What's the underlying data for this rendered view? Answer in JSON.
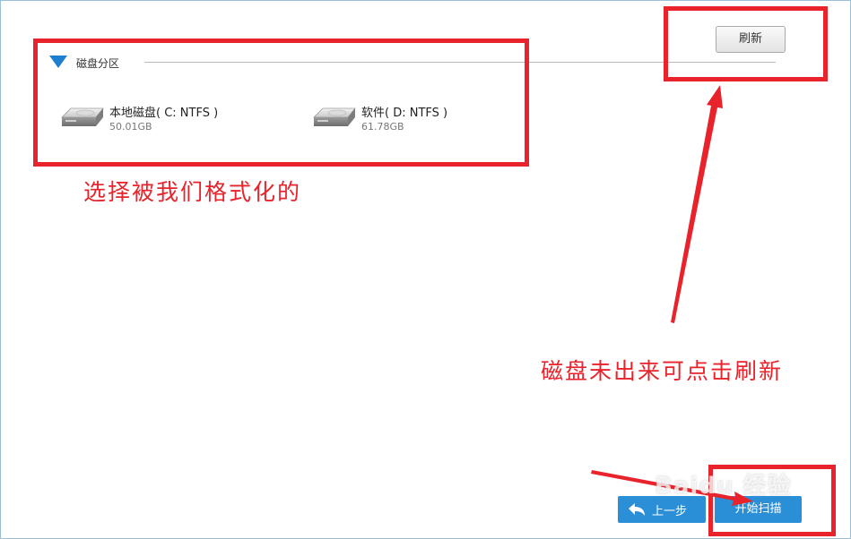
{
  "section": {
    "title": "磁盘分区"
  },
  "disks": [
    {
      "name": "本地磁盘( C: NTFS )",
      "size": "50.01GB",
      "icon": "hard-drive-icon"
    },
    {
      "name": "软件( D: NTFS )",
      "size": "61.78GB",
      "icon": "hard-drive-icon"
    }
  ],
  "toolbar": {
    "refresh_label": "刷新"
  },
  "footer": {
    "back_label": "上一步",
    "scan_label": "开始扫描"
  },
  "annotations": {
    "select_text": "选择被我们格式化的",
    "refresh_text": "磁盘未出来可点击刷新",
    "color": "#e8232b"
  },
  "watermark": {
    "text": "Baidu 经验"
  },
  "colors": {
    "accent": "#2b8fd8",
    "toggle": "#1f7fcf"
  }
}
